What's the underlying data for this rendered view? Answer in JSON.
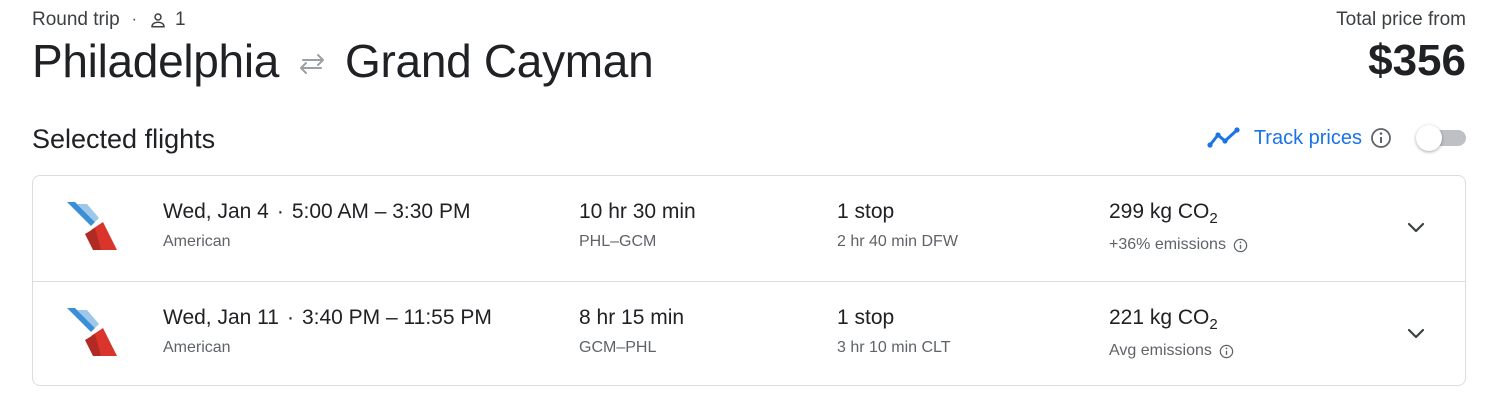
{
  "header": {
    "trip_type": "Round trip",
    "separator": "·",
    "passengers": "1",
    "origin": "Philadelphia",
    "destination": "Grand Cayman",
    "price_label": "Total price from",
    "price": "$356"
  },
  "section": {
    "title": "Selected flights"
  },
  "track_prices": {
    "label": "Track prices",
    "enabled": false
  },
  "flights": [
    {
      "date": "Wed, Jan 4",
      "sep": "·",
      "times": "5:00 AM – 3:30 PM",
      "airline": "American",
      "duration": "10 hr 30 min",
      "route": "PHL–GCM",
      "stops": "1 stop",
      "layover": "2 hr 40 min DFW",
      "emissions_value": "299 kg CO",
      "emissions_sub": "2",
      "emissions_note": "+36% emissions"
    },
    {
      "date": "Wed, Jan 11",
      "sep": "·",
      "times": "3:40 PM – 11:55 PM",
      "airline": "American",
      "duration": "8 hr 15 min",
      "route": "GCM–PHL",
      "stops": "1 stop",
      "layover": "3 hr 10 min CLT",
      "emissions_value": "221 kg CO",
      "emissions_sub": "2",
      "emissions_note": "Avg emissions"
    }
  ],
  "colors": {
    "accent": "#1a73e8",
    "text_primary": "#202124",
    "text_secondary": "#5f6368",
    "border": "#dadce0",
    "airline_blue": "#3a8fd6",
    "airline_red": "#d9352c"
  },
  "icons": {
    "passenger": "person-icon",
    "swap": "swap-arrows-icon",
    "trend": "trending-line-icon",
    "info": "info-icon",
    "expand": "chevron-down-icon",
    "airline_logo": "american-airlines-logo"
  }
}
